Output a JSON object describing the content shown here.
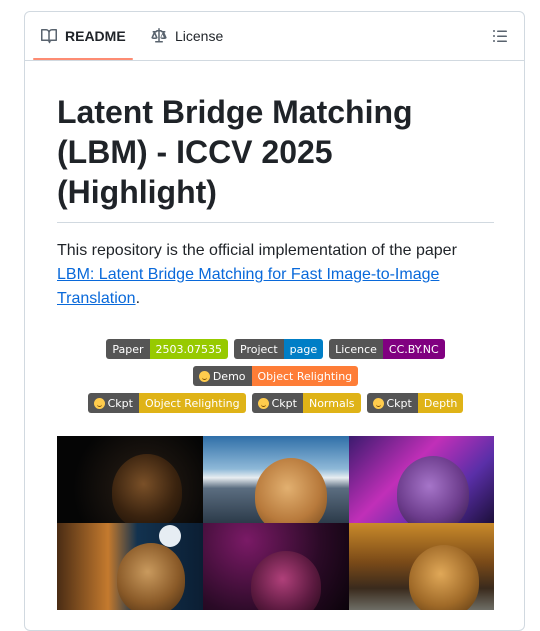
{
  "tabs": {
    "readme_label": "README",
    "license_label": "License"
  },
  "readme": {
    "title": "Latent Bridge Matching (LBM) - ICCV 2025 (Highlight)",
    "intro_text": "This repository is the official implementation of the paper",
    "paper_link_text": "LBM: Latent Bridge Matching for Fast Image-to-Image Translation",
    "intro_end": "."
  },
  "badges": {
    "row1": [
      {
        "label": "Paper",
        "value": "2503.07535",
        "color": "#97ca00"
      },
      {
        "label": "Project",
        "value": "page",
        "color": "#007ec6"
      },
      {
        "label": "Licence",
        "value": "CC.BY.NC",
        "color": "#800080"
      }
    ],
    "row2": [
      {
        "label": "Demo",
        "value": "Object Relighting",
        "color": "#fe7d37"
      }
    ],
    "row3": [
      {
        "label": "Ckpt",
        "value": "Object Relighting",
        "color": "#dfb317"
      },
      {
        "label": "Ckpt",
        "value": "Normals",
        "color": "#dfb317"
      },
      {
        "label": "Ckpt",
        "value": "Depth",
        "color": "#dfb317"
      }
    ]
  },
  "icons": {
    "readme": "book-icon",
    "license": "law-scale-icon",
    "toc": "list-unordered-icon",
    "demo": "hugging-face-icon"
  },
  "colors": {
    "accent": "#fd8c73",
    "link": "#0969da",
    "border": "#d1d9e0"
  }
}
